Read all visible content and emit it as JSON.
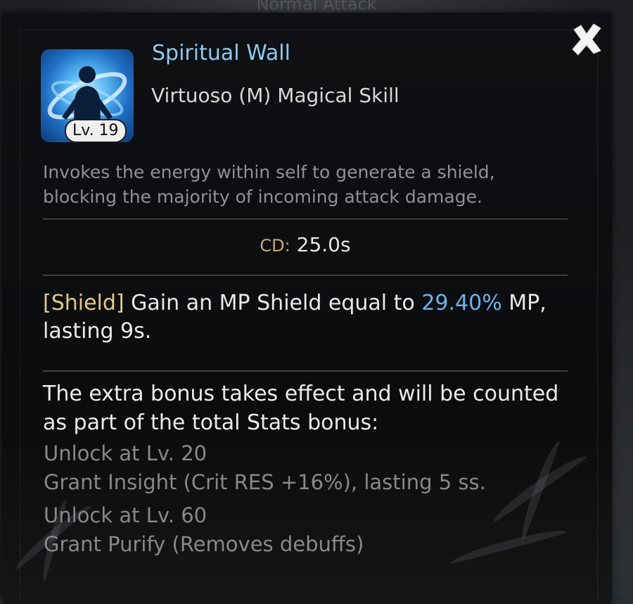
{
  "background": {
    "title": "Normal Attack"
  },
  "skill": {
    "name": "Spiritual Wall",
    "type": "Virtuoso (M) Magical Skill",
    "level": "Lv. 19",
    "icon": "shield-figure-icon",
    "description": "Invokes the energy within self to generate a shield, blocking the majority of incoming attack damage."
  },
  "cooldown": {
    "label": "CD:",
    "value": "25.0s"
  },
  "effect": {
    "tag": "[Shield]",
    "text_before": " Gain an MP Shield equal to ",
    "highlight": "29.40%",
    "text_after": " MP, lasting 9s."
  },
  "bonus": {
    "intro": "The extra bonus takes effect and will be counted as part of the total Stats bonus:",
    "items": [
      {
        "unlock": "Unlock at Lv. 20",
        "effect": "Grant Insight (Crit RES +16%), lasting 5 ss."
      },
      {
        "unlock": "Unlock at Lv. 60",
        "effect": "Grant Purify (Removes debuffs)"
      }
    ]
  },
  "colors": {
    "skill_name": "#8ec9ee",
    "highlight": "#6cb4ec",
    "tag": "#e3c88a",
    "muted_text": "#86898c"
  }
}
